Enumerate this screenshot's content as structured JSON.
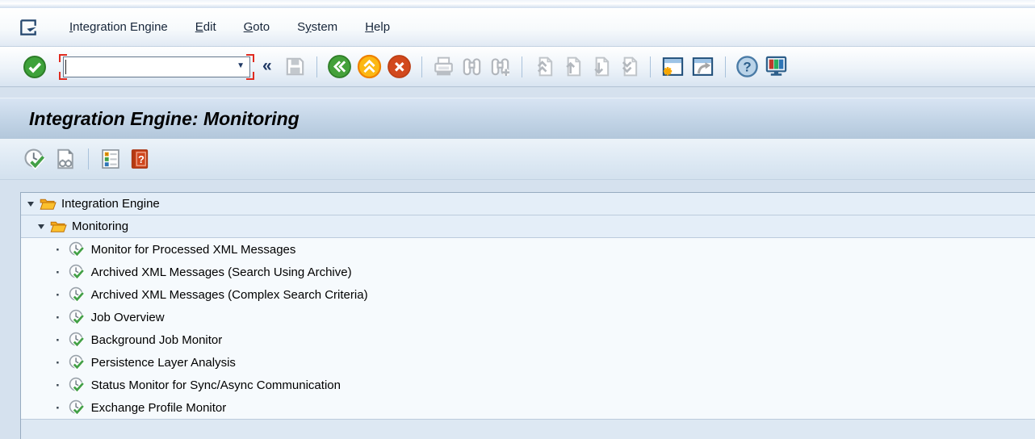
{
  "menu_bar": {
    "items": [
      {
        "pre": "",
        "accel": "I",
        "post": "ntegration Engine"
      },
      {
        "pre": "",
        "accel": "E",
        "post": "dit"
      },
      {
        "pre": "",
        "accel": "G",
        "post": "oto"
      },
      {
        "pre": "S",
        "accel": "y",
        "post": "stem"
      },
      {
        "pre": "",
        "accel": "H",
        "post": "elp"
      }
    ]
  },
  "toolbar": {
    "command_field_value": "",
    "icon_names": [
      "enter-icon",
      "command-field",
      "collapse-icon",
      "save-icon",
      "back-icon",
      "exit-icon",
      "cancel-icon",
      "print-icon",
      "find-icon",
      "find-next-icon",
      "first-page-icon",
      "previous-page-icon",
      "next-page-icon",
      "last-page-icon",
      "new-session-icon",
      "create-shortcut-icon",
      "help-icon",
      "customize-layout-icon"
    ]
  },
  "glyphs": {
    "collapse": "«",
    "dropdown": "▼",
    "help": "?",
    "app_help": "?",
    "bullet": "·"
  },
  "title_bar": {
    "title": "Integration Engine: Monitoring"
  },
  "app_toolbar": {
    "icon_names": [
      "execute-icon",
      "display-icon",
      "legend-icon",
      "application-help-icon"
    ]
  },
  "tree": {
    "nodes": [
      {
        "label": "Integration Engine",
        "type": "folder",
        "depth": 0,
        "expanded": true
      },
      {
        "label": "Monitoring",
        "type": "folder",
        "depth": 1,
        "expanded": true
      },
      {
        "label": "Monitor for Processed XML Messages",
        "type": "leaf",
        "depth": 2
      },
      {
        "label": "Archived XML Messages (Search Using Archive)",
        "type": "leaf",
        "depth": 2
      },
      {
        "label": "Archived XML Messages (Complex Search Criteria)",
        "type": "leaf",
        "depth": 2
      },
      {
        "label": "Job Overview",
        "type": "leaf",
        "depth": 2
      },
      {
        "label": "Background Job Monitor",
        "type": "leaf",
        "depth": 2
      },
      {
        "label": "Persistence Layer Analysis",
        "type": "leaf",
        "depth": 2
      },
      {
        "label": "Status Monitor for Sync/Async Communication",
        "type": "leaf",
        "depth": 2
      },
      {
        "label": "Exchange Profile Monitor",
        "type": "leaf",
        "depth": 2
      }
    ]
  },
  "colors": {
    "title_bar_top": "#d8e4f3",
    "title_bar_bottom": "#b3c7db",
    "folder_row_bg": "#e4eef8",
    "tree_bg": "#f6fafd",
    "accent_navy": "#1f3864",
    "enter_green": "#3ea23a",
    "back_green": "#44a13a",
    "exit_orange": "#fcb813",
    "cancel_red": "#d2491d",
    "folder_yellow": "#f5b91e",
    "bracket_red": "#e02b20"
  }
}
